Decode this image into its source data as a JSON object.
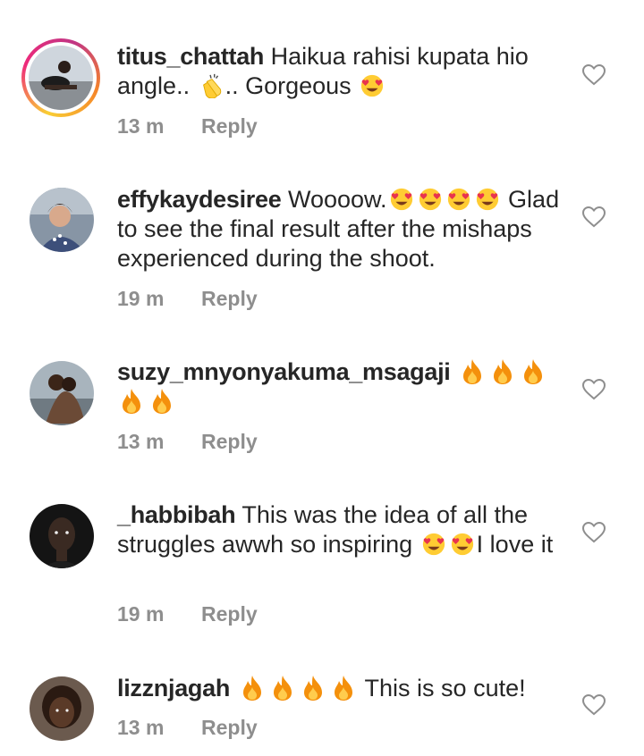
{
  "comments": [
    {
      "username": "titus_chattah",
      "text_parts": [
        "Haikua rahisi kupata hio angle.. ",
        ".. Gorgeous "
      ],
      "time": "13 m",
      "reply": "Reply",
      "has_story_ring": true
    },
    {
      "username": "effykaydesiree",
      "text_parts": [
        "Woooow.",
        "Glad to see the final result after the mishaps experienced during the shoot."
      ],
      "time": "19 m",
      "reply": "Reply"
    },
    {
      "username": "suzy_mnyonyakuma_msagaji",
      "text_parts": [],
      "time": "13 m",
      "reply": "Reply"
    },
    {
      "username": "_habbibah",
      "text_parts": [
        "This was the idea  of all the struggles awwh so inspiring ",
        "I love it"
      ],
      "time": "19 m",
      "reply": "Reply"
    },
    {
      "username": "lizznjagah",
      "text_parts": [
        "This is so cute!"
      ],
      "time": "13 m",
      "reply": "Reply"
    }
  ],
  "icons": {
    "like": "heart-outline-icon",
    "heart_eyes": "heart-eyes-emoji",
    "clap": "clapping-hands-emoji",
    "fire": "fire-emoji"
  },
  "colors": {
    "text": "#262626",
    "meta": "#8e8e8e",
    "story_ring": [
      "#f9ce34",
      "#ee2a7b",
      "#c13584"
    ]
  }
}
